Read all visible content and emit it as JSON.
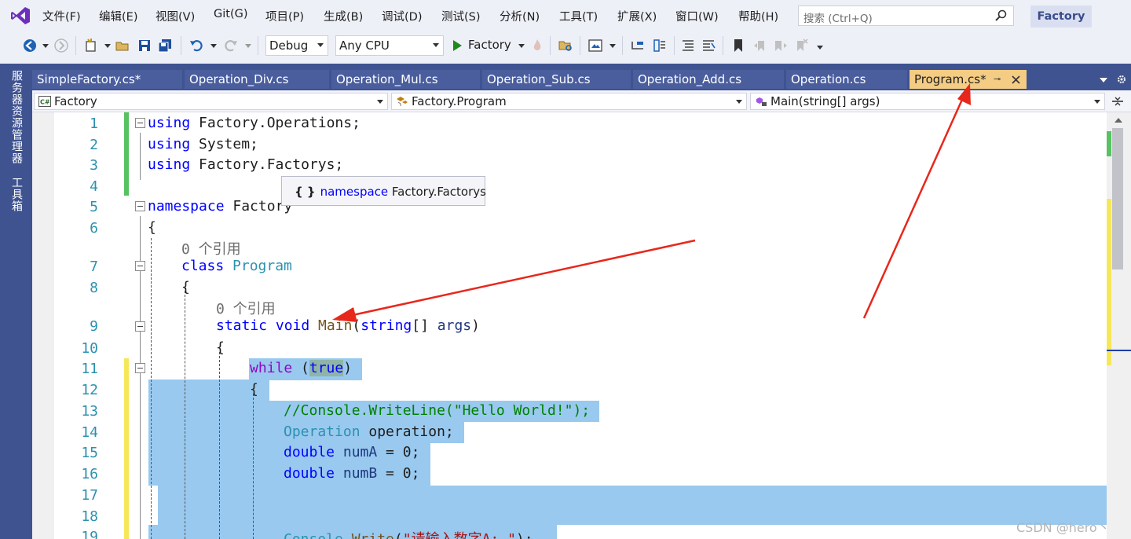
{
  "menu": {
    "items": [
      "文件(F)",
      "编辑(E)",
      "视图(V)",
      "Git(G)",
      "项目(P)",
      "生成(B)",
      "调试(D)",
      "测试(S)",
      "分析(N)",
      "工具(T)",
      "扩展(X)",
      "窗口(W)",
      "帮助(H)"
    ],
    "search_placeholder": "搜索 (Ctrl+Q)",
    "solution_name": "Factory"
  },
  "toolbar": {
    "configuration": "Debug",
    "platform": "Any CPU",
    "start_label": "Factory"
  },
  "side_panel": {
    "tabs": [
      "服务器资源管理器",
      "工具箱"
    ]
  },
  "tabs": [
    {
      "label": "SimpleFactory.cs*",
      "active": false
    },
    {
      "label": "Operation_Div.cs",
      "active": false
    },
    {
      "label": "Operation_Mul.cs",
      "active": false
    },
    {
      "label": "Operation_Sub.cs",
      "active": false
    },
    {
      "label": "Operation_Add.cs",
      "active": false
    },
    {
      "label": "Operation.cs",
      "active": false
    },
    {
      "label": "Program.cs*",
      "active": true
    }
  ],
  "navbar": {
    "project": "Factory",
    "type": "Factory.Program",
    "member": "Main(string[] args)"
  },
  "editor": {
    "line_numbers": [
      "1",
      "2",
      "3",
      "4",
      "5",
      "6",
      "7",
      "8",
      "9",
      "10",
      "11",
      "12",
      "13",
      "14",
      "15",
      "16",
      "17",
      "18",
      "19"
    ],
    "codelens_class": "0 个引用",
    "codelens_method": "0 个引用",
    "lines": {
      "l1_kw": "using",
      "l1_rest": " Factory.Operations;",
      "l2_kw": "using",
      "l2_rest": " System;",
      "l3_kw": "using",
      "l3_rest": " Factory.Factorys;",
      "l5_kw": "namespace",
      "l5_rest": " Factory",
      "l6": "{",
      "l7_kw": "class",
      "l7_name": " Program",
      "l8": "{",
      "l9_kw1": "static",
      "l9_kw2": " void",
      "l9_name": " Main",
      "l9_open": "(",
      "l9_kw3": "string",
      "l9_mid": "[] ",
      "l9_param": "args",
      "l9_close": ")",
      "l10": "{",
      "l11_kw": "while",
      "l11_open": " (",
      "l11_val": "true",
      "l11_close": ")",
      "l12": "{",
      "l13": "//Console.WriteLine(\"Hello World!\");",
      "l14_type": "Operation",
      "l14_rest": " operation;",
      "l15_kw": "double",
      "l15_var": " numA",
      "l15_rest": " = 0;",
      "l16_kw": "double",
      "l16_var": " numB",
      "l16_rest": " = 0;",
      "l19_obj": "Console",
      "l19_dot": ".",
      "l19_m": "Write",
      "l19_open": "(",
      "l19_str": "\"请输入数字A: \"",
      "l19_close": ");"
    }
  },
  "tooltip": {
    "keyword": "namespace",
    "name": " Factory.Factorys"
  },
  "watermark": "CSDN @hero丶"
}
